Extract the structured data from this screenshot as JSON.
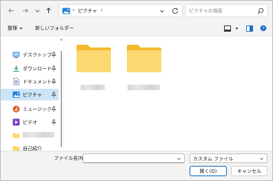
{
  "address": {
    "location": "ピクチャ",
    "separator": "›"
  },
  "search": {
    "placeholder": "ピクチャの検索"
  },
  "toolbar": {
    "organize_label": "整理",
    "new_folder_label": "新しいフォルダー"
  },
  "sidebar": {
    "items": [
      {
        "label": "デスクトップ",
        "icon": "desktop-icon",
        "pinned": true
      },
      {
        "label": "ダウンロード",
        "icon": "download-icon",
        "pinned": true
      },
      {
        "label": "ドキュメント",
        "icon": "document-icon",
        "pinned": true
      },
      {
        "label": "ピクチャ",
        "icon": "pictures-icon",
        "pinned": true,
        "selected": true
      },
      {
        "label": "ミュージック",
        "icon": "music-icon",
        "pinned": true
      },
      {
        "label": "ビデオ",
        "icon": "video-icon",
        "pinned": true
      },
      {
        "label": "",
        "icon": "folder-icon",
        "pinned": false,
        "name_redacted": true
      },
      {
        "label": "自己紹介",
        "icon": "folder-icon",
        "pinned": false
      }
    ]
  },
  "content": {
    "folders": [
      {
        "name_redacted": true
      },
      {
        "name_redacted": true
      }
    ]
  },
  "bottom": {
    "filename_label": "ファイル名(N):",
    "filename_value": "",
    "filetype_value": "カスタム ファイル",
    "open_label": "開く(O)",
    "cancel_label": "キャンセル"
  },
  "colors": {
    "accent": "#0067c0",
    "selection": "#cce4f7",
    "folder": "#f8c94a"
  }
}
